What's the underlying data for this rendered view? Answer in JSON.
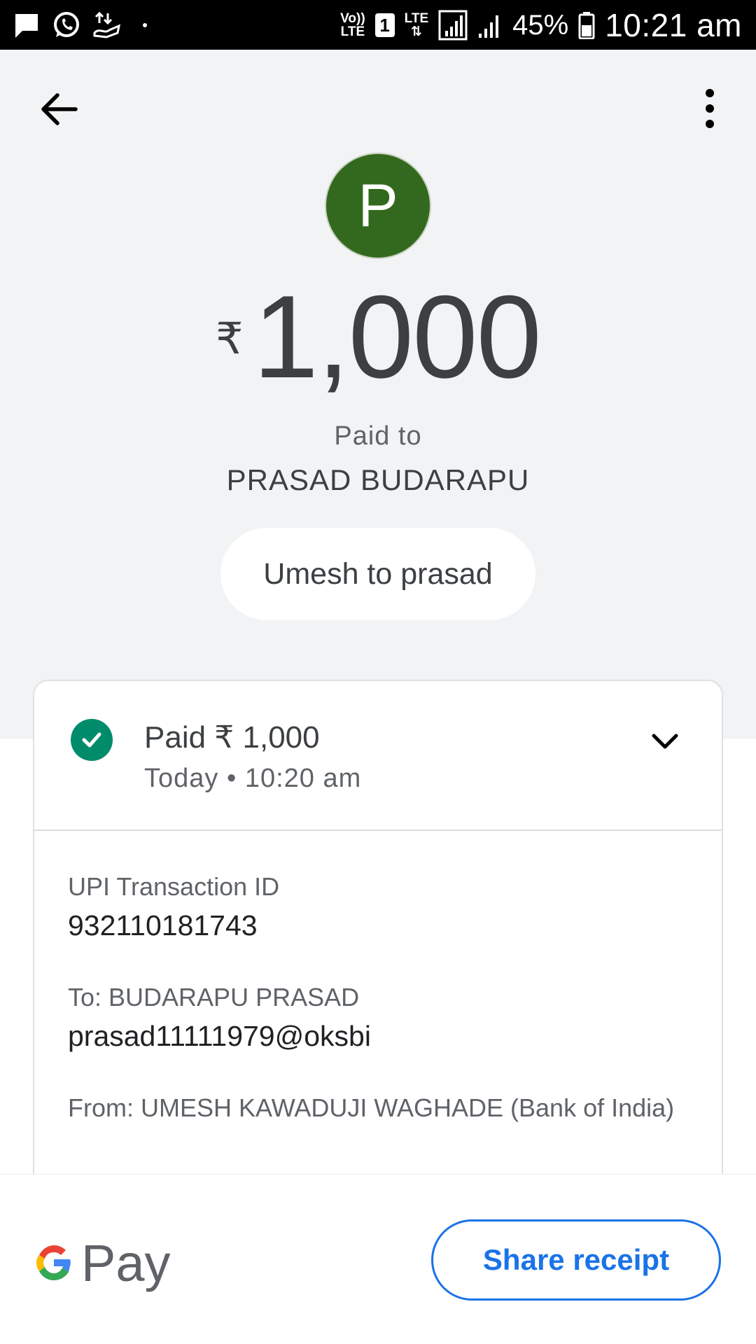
{
  "status_bar": {
    "time": "10:21 am",
    "battery_percent": "45%",
    "volte_top": "Vo))",
    "volte_bottom": "LTE",
    "sim_number": "1",
    "lte_label": "LTE",
    "notification_icons": [
      "message-icon",
      "whatsapp-icon",
      "upload-icon"
    ]
  },
  "header": {
    "back_icon": "arrow-left-icon",
    "more_icon": "more-vert-icon"
  },
  "payee": {
    "avatar_letter": "P",
    "avatar_color": "#33691e",
    "paid_to_label": "Paid to",
    "name": "PRASAD BUDARAPU"
  },
  "amount": {
    "currency_symbol": "₹",
    "value": "1,000"
  },
  "note": "Umesh to prasad",
  "transaction": {
    "status_title": "Paid ₹ 1,000",
    "status_time": "Today • 10:20 am",
    "status_color": "#008b6b",
    "details": [
      {
        "label": "UPI Transaction ID",
        "value": "932110181743"
      },
      {
        "label": "To: BUDARAPU  PRASAD",
        "value": "prasad11111979@oksbi"
      },
      {
        "label": "From: UMESH KAWADUJI WAGHADE (Bank of India)",
        "value": ""
      }
    ]
  },
  "footer": {
    "brand_text": "Pay",
    "share_label": "Share receipt",
    "accent_color": "#1a73e8"
  }
}
